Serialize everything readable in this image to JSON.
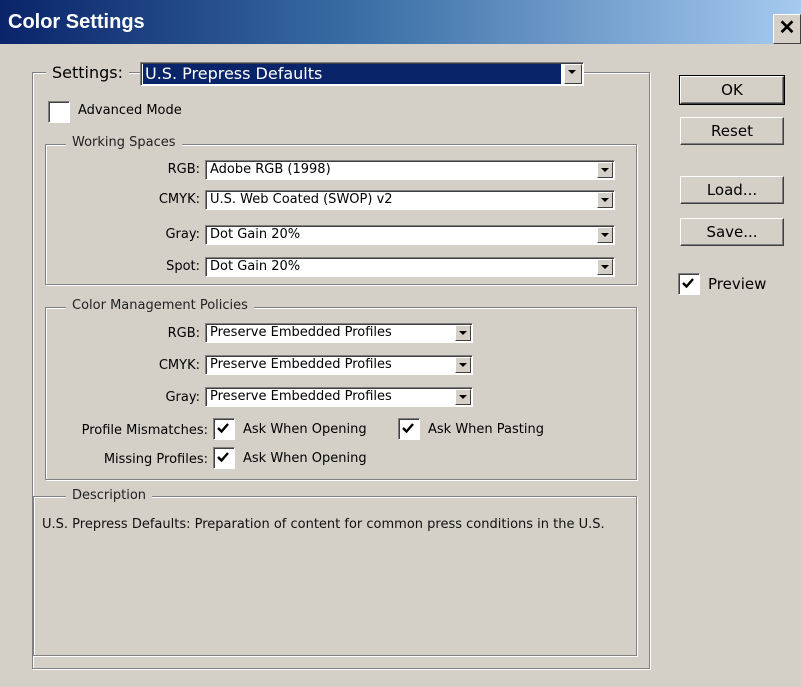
{
  "window": {
    "title": "Color Settings",
    "close_icon": "close-icon"
  },
  "settings": {
    "label": "Settings:",
    "value": "U.S. Prepress Defaults"
  },
  "advanced_mode": {
    "label": "Advanced Mode",
    "checked": false
  },
  "working_spaces": {
    "legend": "Working Spaces",
    "rows": [
      {
        "label": "RGB:",
        "value": "Adobe RGB (1998)"
      },
      {
        "label": "CMYK:",
        "value": "U.S. Web Coated (SWOP) v2"
      },
      {
        "label": "Gray:",
        "value": "Dot Gain 20%"
      },
      {
        "label": "Spot:",
        "value": "Dot Gain 20%"
      }
    ]
  },
  "policies": {
    "legend": "Color Management Policies",
    "rows": [
      {
        "label": "RGB:",
        "value": "Preserve Embedded Profiles"
      },
      {
        "label": "CMYK:",
        "value": "Preserve Embedded Profiles"
      },
      {
        "label": "Gray:",
        "value": "Preserve Embedded Profiles"
      }
    ],
    "profile_mismatches": {
      "label": "Profile Mismatches:",
      "ask_opening": "Ask When Opening",
      "ask_pasting": "Ask When Pasting"
    },
    "missing_profiles": {
      "label": "Missing Profiles:",
      "ask_opening": "Ask When Opening"
    }
  },
  "description": {
    "legend": "Description",
    "text": "U.S. Prepress Defaults:  Preparation of content for common press conditions in the U.S."
  },
  "buttons": {
    "ok": "OK",
    "reset": "Reset",
    "load": "Load...",
    "save": "Save..."
  },
  "preview": {
    "label": "Preview",
    "checked": true
  }
}
